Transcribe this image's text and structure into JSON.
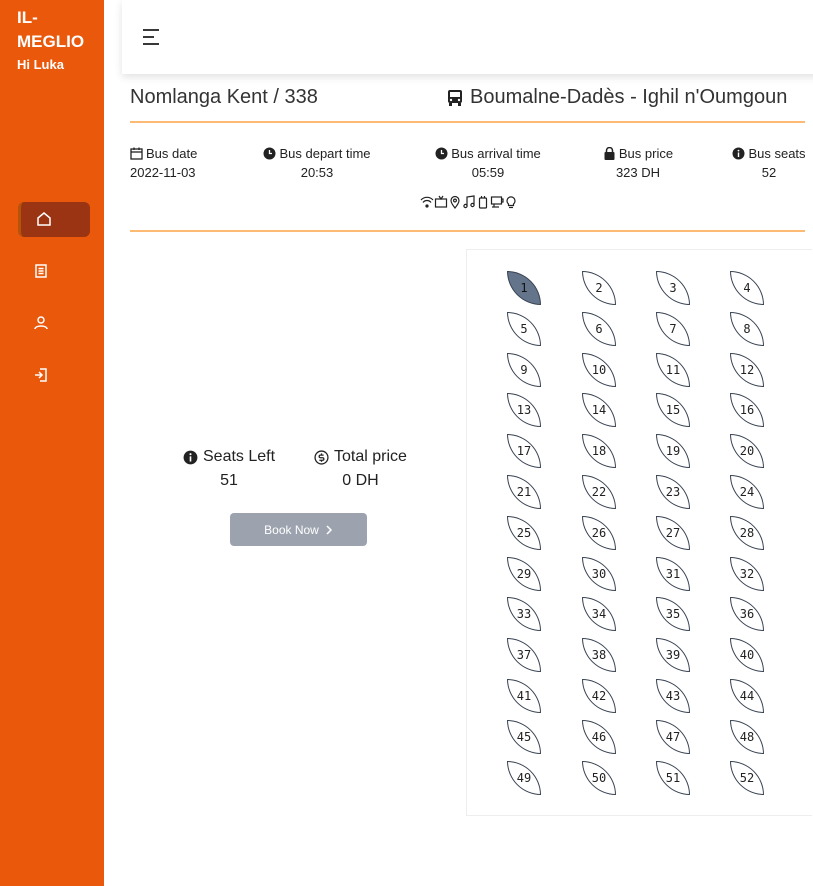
{
  "sidebar": {
    "brand": "IL-MEGLIO",
    "greeting": "Hi Luka",
    "items": [
      {
        "icon": "home-icon",
        "active": true
      },
      {
        "icon": "document-icon",
        "active": false
      },
      {
        "icon": "user-icon",
        "active": false
      },
      {
        "icon": "logout-icon",
        "active": false
      }
    ]
  },
  "header": {
    "agency": "Nomlanga Kent / 338",
    "route": "Boumalne-Dadès - Ighil n'Oumgoun"
  },
  "info": {
    "date_label": "Bus date",
    "date_value": "2022-11-03",
    "depart_label": "Bus depart time",
    "depart_value": "20:53",
    "arrival_label": "Bus arrival time",
    "arrival_value": "05:59",
    "price_label": "Bus price",
    "price_value": "323 DH",
    "seats_label": "Bus seats",
    "seats_value": "52"
  },
  "amenities": [
    "wifi-icon",
    "tv-icon",
    "location-pin-icon",
    "music-icon",
    "plug-icon",
    "coffee-icon",
    "lightbulb-icon"
  ],
  "summary": {
    "seats_left_label": "Seats Left",
    "seats_left_value": "51",
    "total_price_label": "Total price",
    "total_price_value": "0 DH",
    "book_label": "Book Now"
  },
  "seats": {
    "total": 52,
    "selected": [
      1
    ]
  },
  "colors": {
    "sidebar": "#ea580c",
    "active_nav": "#9a3412",
    "divider": "#fdba74",
    "selected_seat": "#64748b",
    "button_disabled": "#9ca3af"
  }
}
